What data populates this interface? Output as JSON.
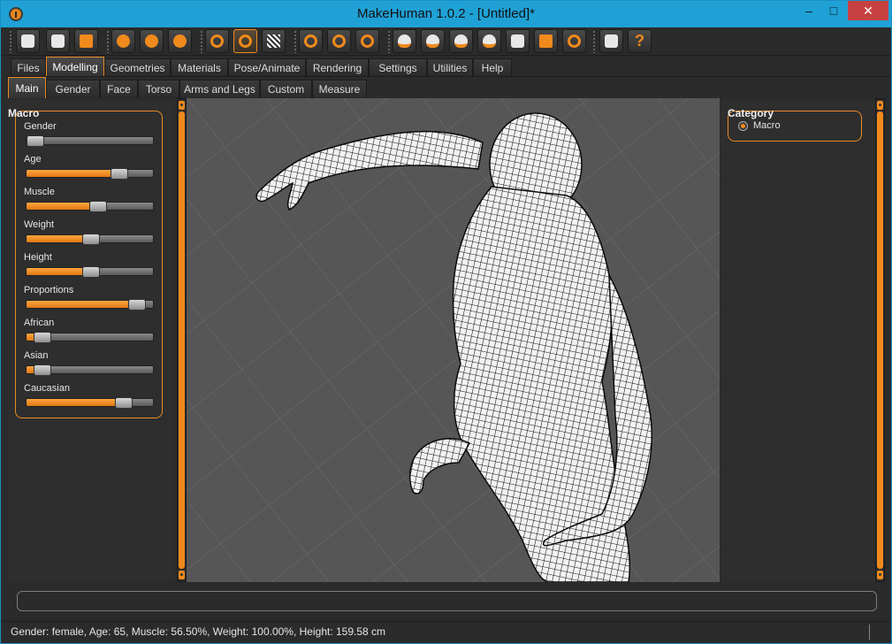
{
  "window": {
    "title": "MakeHuman 1.0.2 - [Untitled]*",
    "controls": {
      "minimize": "–",
      "maximize": "□",
      "close": "✕"
    },
    "accent": "#f08a1c",
    "titlebar_color": "#1fa1d6"
  },
  "toolbar": {
    "buttons": [
      {
        "name": "load-icon"
      },
      {
        "name": "save-icon"
      },
      {
        "name": "export-icon"
      },
      {
        "name": "undo-icon"
      },
      {
        "name": "redo-icon"
      },
      {
        "name": "reset-icon"
      },
      {
        "name": "smooth-icon"
      },
      {
        "name": "wireframe-icon",
        "active": true
      },
      {
        "name": "background-icon"
      },
      {
        "name": "front-view-icon"
      },
      {
        "name": "back-view-icon"
      },
      {
        "name": "left-view-icon"
      },
      {
        "name": "right-view-icon"
      },
      {
        "name": "top-view-icon"
      },
      {
        "name": "bottom-view-icon"
      },
      {
        "name": "head-view-icon"
      },
      {
        "name": "face-view-icon"
      },
      {
        "name": "torso-view-icon"
      },
      {
        "name": "pose-icon"
      },
      {
        "name": "screenshot-icon"
      },
      {
        "name": "help-icon"
      }
    ]
  },
  "menu_tabs": [
    "Files",
    "Modelling",
    "Geometries",
    "Materials",
    "Pose/Animate",
    "Rendering",
    "Settings",
    "Utilities",
    "Help"
  ],
  "menu_active": "Modelling",
  "sub_tabs": [
    "Main",
    "Gender",
    "Face",
    "Torso",
    "Arms and Legs",
    "Custom",
    "Measure"
  ],
  "sub_active": "Main",
  "macro": {
    "title": "Macro",
    "sliders": [
      {
        "label": "Gender",
        "value": 0.0
      },
      {
        "label": "Age",
        "value": 0.76
      },
      {
        "label": "Muscle",
        "value": 0.565
      },
      {
        "label": "Weight",
        "value": 0.5
      },
      {
        "label": "Height",
        "value": 0.5
      },
      {
        "label": "Proportions",
        "value": 0.92
      },
      {
        "label": "African",
        "value": 0.06
      },
      {
        "label": "Asian",
        "value": 0.06
      },
      {
        "label": "Caucasian",
        "value": 0.8
      }
    ]
  },
  "category": {
    "title": "Category",
    "option": "Macro"
  },
  "command_line": "",
  "status": "Gender: female, Age: 65, Muscle: 56.50%, Weight: 100.00%, Height: 159.58 cm"
}
